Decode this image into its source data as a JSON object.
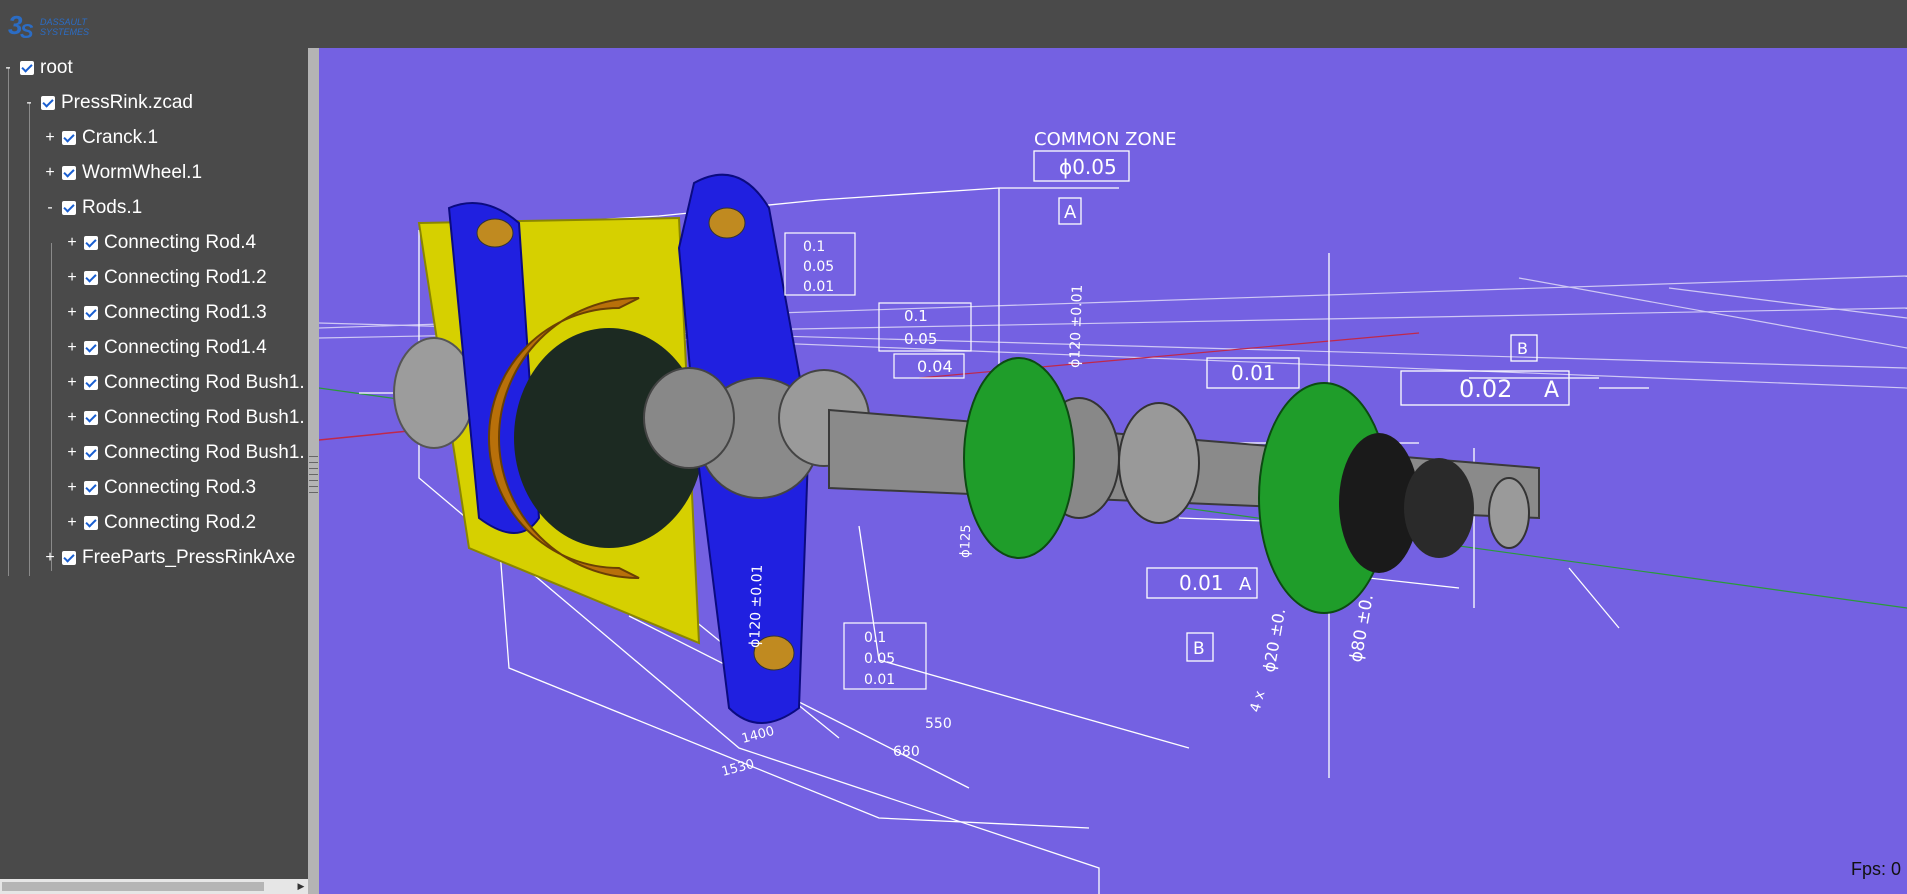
{
  "app": {
    "logo_text_line1": "DASSAULT",
    "logo_text_line2": "SYSTEMES",
    "logo_icon": "3ds-logo-icon"
  },
  "tree": [
    {
      "toggle": "-",
      "label": "root",
      "checked": true
    },
    {
      "toggle": "-",
      "label": "PressRink.zcad",
      "checked": true
    },
    {
      "toggle": "+",
      "label": "Cranck.1",
      "checked": true
    },
    {
      "toggle": "+",
      "label": "WormWheel.1",
      "checked": true
    },
    {
      "toggle": "-",
      "label": "Rods.1",
      "checked": true
    },
    {
      "toggle": "+",
      "label": "Connecting Rod.4",
      "checked": true
    },
    {
      "toggle": "+",
      "label": "Connecting Rod1.2",
      "checked": true
    },
    {
      "toggle": "+",
      "label": "Connecting Rod1.3",
      "checked": true
    },
    {
      "toggle": "+",
      "label": "Connecting Rod1.4",
      "checked": true
    },
    {
      "toggle": "+",
      "label": "Connecting Rod Bush1.",
      "checked": true
    },
    {
      "toggle": "+",
      "label": "Connecting Rod Bush1.",
      "checked": true
    },
    {
      "toggle": "+",
      "label": "Connecting Rod Bush1.",
      "checked": true
    },
    {
      "toggle": "+",
      "label": "Connecting Rod.3",
      "checked": true
    },
    {
      "toggle": "+",
      "label": "Connecting Rod.2",
      "checked": true
    },
    {
      "toggle": "+",
      "label": "FreeParts_PressRinkAxe",
      "checked": true
    }
  ],
  "viewport": {
    "background": "#7461e2",
    "fps": "Fps: 0",
    "annotations": {
      "common_zone": "COMMON ZONE",
      "tol_005": "ϕ0.05",
      "datum_a": "A",
      "datum_b": "B",
      "fcf_01": "0.1",
      "fcf_005": "0.05",
      "fcf_001": "0.01",
      "fcf_004": "0.04",
      "fcf_002": "0.02",
      "dim_1400": "1400",
      "dim_1530": "1530",
      "dim_680": "680",
      "dim_550": "550",
      "dim_4x": "4 x",
      "dim_phi80": "ϕ80 ±0.",
      "dim_phi20": "ϕ20 ±0.",
      "dim_phi120": "ϕ120 ±0.01",
      "dim_phi125": "ϕ125"
    },
    "colors": {
      "blue_part": "#2020e0",
      "yellow_plate": "#d6d000",
      "gear": "#b8700a",
      "green_flange": "#1f9d2a",
      "gray_shaft": "#8a8a8a"
    }
  }
}
